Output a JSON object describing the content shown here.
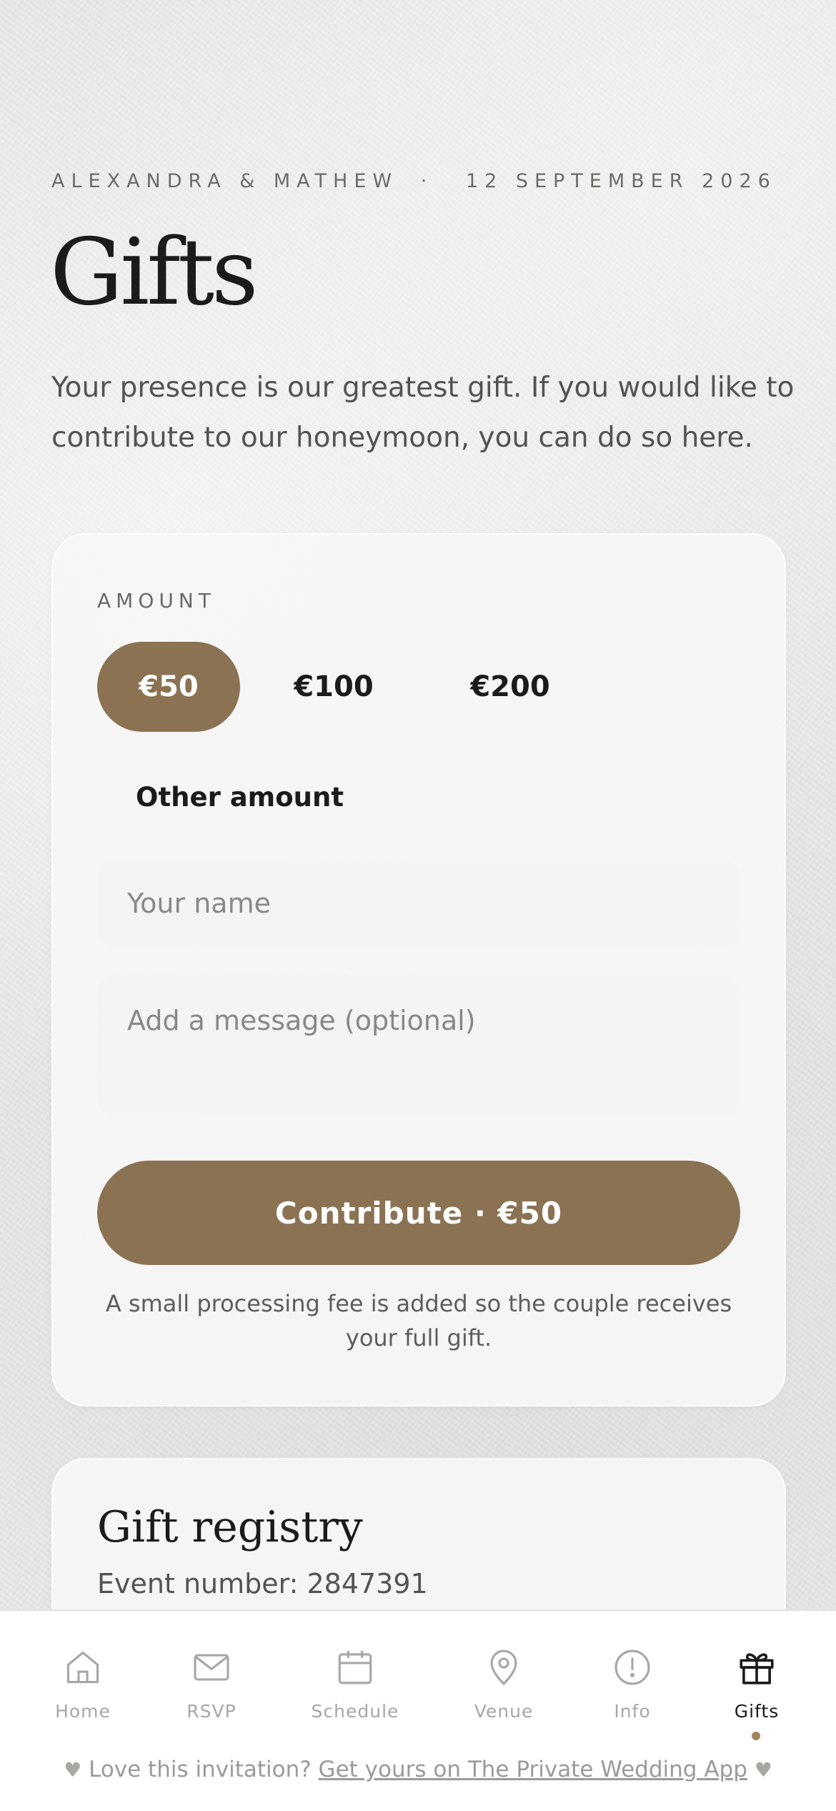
{
  "header": {
    "couple": "ALEXANDRA & MATHEW",
    "separator": "·",
    "date": "12 SEPTEMBER 2026"
  },
  "page": {
    "title": "Gifts",
    "intro": "Your presence is our greatest gift. If you would like to contribute to our honeymoon, you can do so here."
  },
  "contribution": {
    "amount_label": "AMOUNT",
    "amounts": [
      "€50",
      "€100",
      "€200"
    ],
    "selected_amount": "€50",
    "other_amount": "Other amount",
    "name_placeholder": "Your name",
    "message_placeholder": "Add a message (optional)",
    "button_label": "Contribute · €50",
    "fee_note": "A small processing fee is added so the couple receives your full gift."
  },
  "registry": {
    "title": "Gift registry",
    "event_number": "Event number: 2847391"
  },
  "tabbar": {
    "items": [
      {
        "label": "Home",
        "icon": "home-icon"
      },
      {
        "label": "RSVP",
        "icon": "envelope-icon"
      },
      {
        "label": "Schedule",
        "icon": "calendar-icon"
      },
      {
        "label": "Venue",
        "icon": "map-pin-icon"
      },
      {
        "label": "Info",
        "icon": "info-icon"
      },
      {
        "label": "Gifts",
        "icon": "gift-icon"
      }
    ],
    "active": "Gifts"
  },
  "footer": {
    "text": "Love this invitation?",
    "link": "Get yours on The Private Wedding App"
  },
  "colors": {
    "accent": "#8a7253",
    "text_dark": "#1c1b19",
    "inactive": "#a9a7a4"
  }
}
